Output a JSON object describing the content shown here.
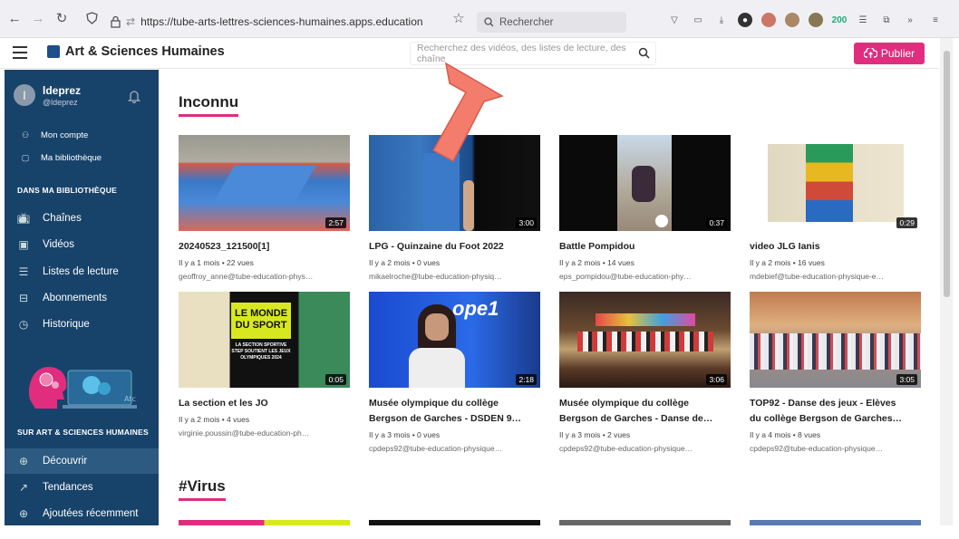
{
  "browser": {
    "url_prefix": "https://tube-arts-lettres-sciences-humaines.apps.education.fr/videos",
    "search_placeholder": "Rechercher",
    "badge": "200"
  },
  "header": {
    "title": "Art & Sciences Humaines",
    "search_placeholder": "Recherchez des vidéos, des listes de lecture, des chaîne",
    "publish_label": "Publier"
  },
  "sidebar": {
    "user_initial": "l",
    "username": "ldeprez",
    "handle": "@ldeprez",
    "account": [
      {
        "label": "Mon compte",
        "icon": "person-icon"
      },
      {
        "label": "Ma bibliothèque",
        "icon": "library-icon"
      }
    ],
    "library_heading": "DANS MA BIBLIOTHÈQUE",
    "library": [
      {
        "label": "Chaînes",
        "icon": "tv-icon"
      },
      {
        "label": "Vidéos",
        "icon": "video-icon"
      },
      {
        "label": "Listes de lecture",
        "icon": "list-icon"
      },
      {
        "label": "Abonnements",
        "icon": "inbox-icon"
      },
      {
        "label": "Historique",
        "icon": "history-icon"
      }
    ],
    "site_heading": "SUR ART & SCIENCES HUMAINES",
    "site": [
      {
        "label": "Découvrir",
        "icon": "globe-icon"
      },
      {
        "label": "Tendances",
        "icon": "trending-icon"
      },
      {
        "label": "Ajoutées récemment",
        "icon": "plus-circle-icon"
      }
    ]
  },
  "sections": [
    {
      "title": "Inconnu"
    },
    {
      "title": "#Virus"
    }
  ],
  "videos": [
    {
      "title": "20240523_121500[1]",
      "meta": "Il y a 1 mois • 22 vues",
      "owner": "geoffroy_anne@tube-education-phys…",
      "duration": "2:57"
    },
    {
      "title": "LPG - Quinzaine du Foot 2022",
      "meta": "Il y a 2 mois • 0 vues",
      "owner": "mikaelroche@tube-education-physiq…",
      "duration": "3:00"
    },
    {
      "title": "Battle Pompidou",
      "meta": "Il y a 2 mois • 14 vues",
      "owner": "eps_pompidou@tube-education-phy…",
      "duration": "0:37"
    },
    {
      "title": "video JLG Ianis",
      "meta": "Il y a 2 mois • 16 vues",
      "owner": "mdebief@tube-education-physique-e…",
      "duration": "0:29"
    },
    {
      "title": "La section et les JO",
      "meta": "Il y a 2 mois • 4 vues",
      "owner": "virginie.poussin@tube-education-ph…",
      "duration": "0:05",
      "overlay": "LE MONDE DU SPORT",
      "overlay2": "LA SECTION SPORTIVE STEP SOUTIENT LES JEUX OLYMPIQUES 2024"
    },
    {
      "title": "Musée olympique du collège\nBergson de Garches - DSDEN 9…",
      "meta": "Il y a 3 mois • 0 vues",
      "owner": "cpdeps92@tube-education-physique…",
      "duration": "2:18",
      "overlay": "ope1"
    },
    {
      "title": "Musée olympique du collège\nBergson de Garches - Danse de…",
      "meta": "Il y a 3 mois • 2 vues",
      "owner": "cpdeps92@tube-education-physique…",
      "duration": "3:06"
    },
    {
      "title": "TOP92 - Danse des jeux - Elèves\ndu collège Bergson de Garches…",
      "meta": "Il y a 4 mois • 8 vues",
      "owner": "cpdeps92@tube-education-physique…",
      "duration": "3:05"
    }
  ]
}
